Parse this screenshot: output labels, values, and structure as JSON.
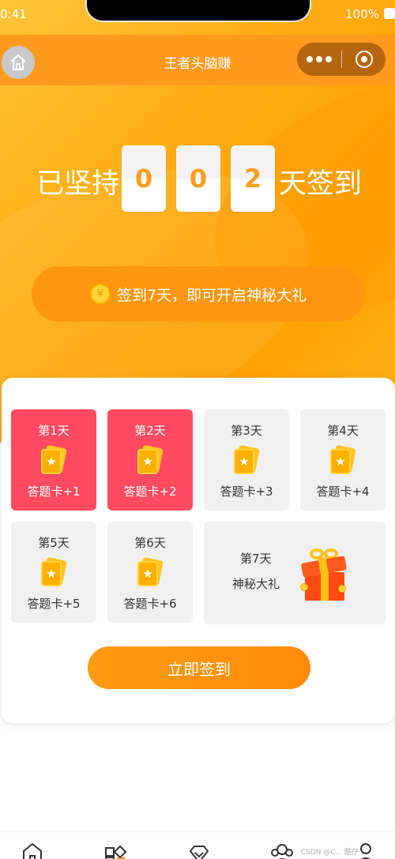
{
  "status_bar": {
    "time": "0:41",
    "battery": "100%"
  },
  "nav": {
    "title": "王者头脑赚",
    "home_icon": "home-icon",
    "more_icon": "more-dots-icon",
    "close_icon": "target-close-icon"
  },
  "streak": {
    "prefix": "已坚持",
    "digits": [
      "0",
      "0",
      "2"
    ],
    "suffix": "天签到"
  },
  "promo": {
    "coin_symbol": "¥",
    "text": "签到7天，即可开启神秘大礼"
  },
  "days": [
    {
      "label": "第1天",
      "reward": "答题卡+1",
      "checked": true
    },
    {
      "label": "第2天",
      "reward": "答题卡+2",
      "checked": true
    },
    {
      "label": "第3天",
      "reward": "答题卡+3",
      "checked": false
    },
    {
      "label": "第4天",
      "reward": "答题卡+4",
      "checked": false
    },
    {
      "label": "第5天",
      "reward": "答题卡+5",
      "checked": false
    },
    {
      "label": "第6天",
      "reward": "答题卡+6",
      "checked": false
    }
  ],
  "final_day": {
    "label": "第7天",
    "reward": "神秘大礼",
    "icon": "gift-box-icon"
  },
  "checkin_button": "立即签到",
  "colors": {
    "accent": "#ff9a1e",
    "checked_day": "#ff4a5f",
    "pending_day": "#f0f0f0"
  },
  "tabbar": {
    "icons": [
      "home-icon",
      "category-icon",
      "diamond-icon",
      "group-icon",
      "profile-icon"
    ]
  },
  "watermark": "CSDN @C... 酷仔"
}
